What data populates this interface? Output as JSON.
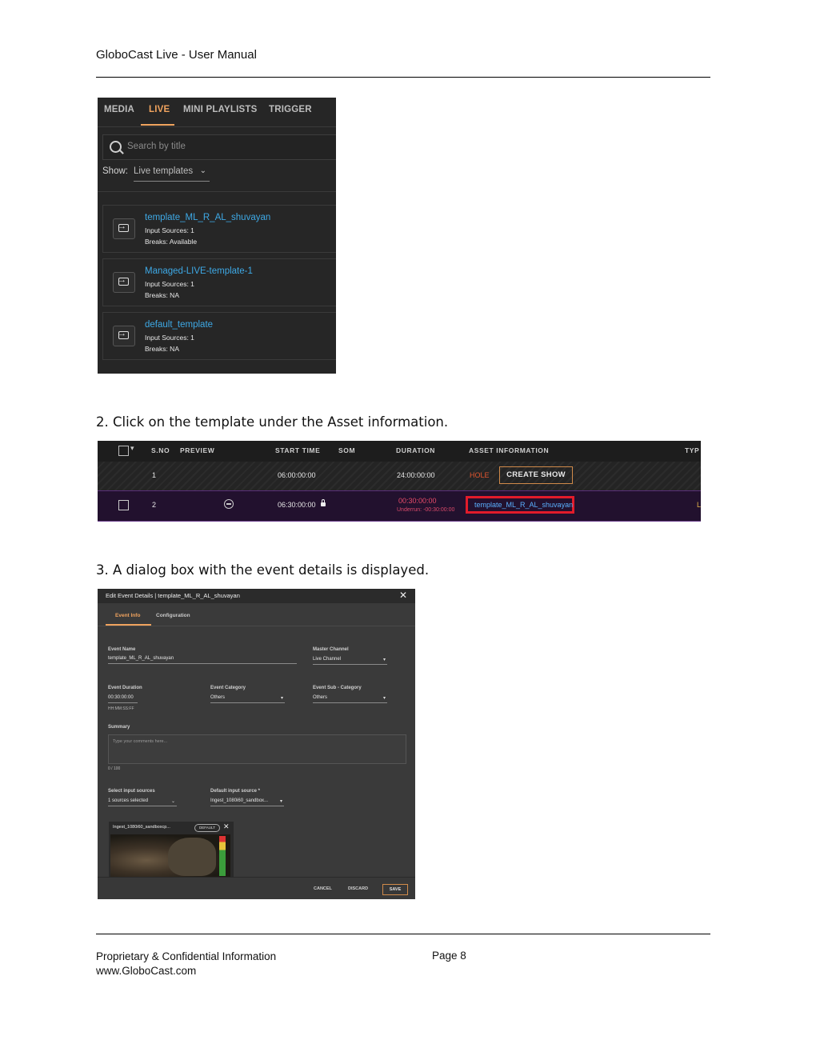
{
  "header": {
    "title": "GloboCast Live - User Manual"
  },
  "shot1": {
    "tabs": [
      "MEDIA",
      "LIVE",
      "MINI PLAYLISTS",
      "TRIGGER"
    ],
    "active_tab": "LIVE",
    "search_placeholder": "Search by title",
    "show_label": "Show:",
    "show_value": "Live templates",
    "templates": [
      {
        "name": "template_ML_R_AL_shuvayan",
        "input_sources": "Input Sources: 1",
        "breaks": "Breaks: Available"
      },
      {
        "name": "Managed-LIVE-template-1",
        "input_sources": "Input Sources: 1",
        "breaks": "Breaks: NA"
      },
      {
        "name": "default_template",
        "input_sources": "Input Sources: 1",
        "breaks": "Breaks: NA"
      }
    ]
  },
  "step2": "2. Click on the template under the Asset information.",
  "shot2": {
    "columns": [
      "S.NO",
      "PREVIEW",
      "START TIME",
      "SOM",
      "DURATION",
      "ASSET INFORMATION",
      "TYP"
    ],
    "row1": {
      "sno": "1",
      "start": "06:00:00:00",
      "duration": "24:00:00:00",
      "asset_status": "HOLE",
      "create_show": "CREATE SHOW"
    },
    "row2": {
      "sno": "2",
      "start": "06:30:00:00",
      "duration": "00:30:00:00",
      "underrun": "Underrun: -00:30:00:00",
      "asset": "template_ML_R_AL_shuvayan",
      "trail": "L"
    }
  },
  "step3": "3. A dialog box with the event details is displayed.",
  "shot3": {
    "title": "Edit Event Details | template_ML_R_AL_shuvayan",
    "close": "✕",
    "tabs": [
      "Event Info",
      "Configuration"
    ],
    "event_name_label": "Event Name",
    "event_name_value": "template_ML_R_AL_shuvayan",
    "master_channel_label": "Master Channel",
    "master_channel_value": "Live Channel",
    "event_duration_label": "Event Duration",
    "event_duration_value": "00:30:00:00",
    "event_duration_hint": "HH:MM:SS:FF",
    "event_category_label": "Event Category",
    "event_category_value": "Others",
    "event_subcategory_label": "Event Sub - Category",
    "event_subcategory_value": "Others",
    "summary_label": "Summary",
    "summary_placeholder": "Type your comments here...",
    "summary_count": "0 / 100",
    "input_sources_label": "Select input sources",
    "input_sources_value": "1 sources selected",
    "default_source_label": "Default input source *",
    "default_source_value": "Ingest_1080i60_sandbox...",
    "source_card_name": "Ingest_1080i60_sandboxcp...",
    "source_card_default": "DEFAULT",
    "source_card_close": "✕",
    "buttons": {
      "cancel": "CANCEL",
      "discard": "DISCARD",
      "save": "SAVE"
    }
  },
  "footer": {
    "left_line1": "Proprietary & Confidential Information",
    "left_line2": "www.GloboCast.com",
    "page": "Page 8"
  }
}
